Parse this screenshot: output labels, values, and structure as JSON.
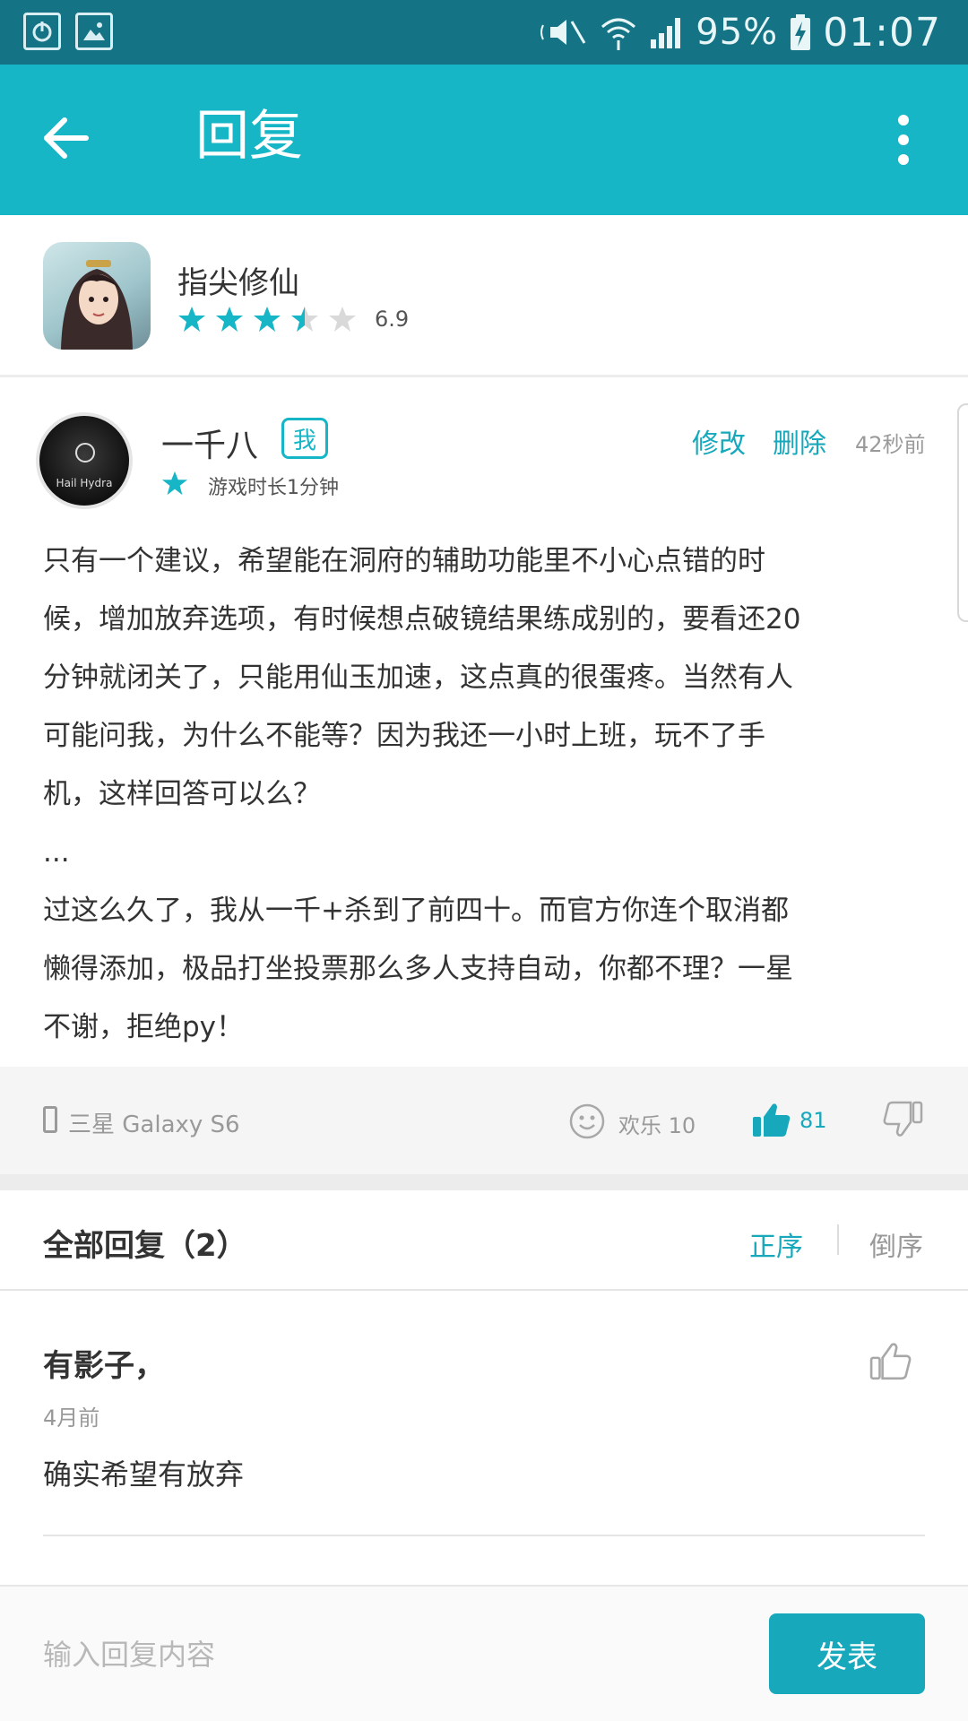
{
  "status_bar": {
    "battery": "95%",
    "time": "01:07",
    "icons": [
      "power-icon",
      "image-icon",
      "mute-icon",
      "wifi-icon",
      "signal-icon",
      "battery-charging-icon"
    ]
  },
  "app_bar": {
    "title": "回复",
    "back_icon": "arrow-left-icon",
    "menu_icon": "more-vertical-icon",
    "background": "#17b6c6"
  },
  "game": {
    "name": "指尖修仙",
    "rating": 3.5,
    "rating_max": 5,
    "score": "6.9"
  },
  "review": {
    "username": "一千八",
    "me_badge": "我",
    "play_time": "游戏时长1分钟",
    "edit": "修改",
    "delete": "删除",
    "time_ago": "42秒前",
    "avatar_text": "Hail Hydra",
    "body": "只有一个建议，希望能在洞府的辅助功能里不小心点错的时\n候，增加放弃选项，有时候想点破镜结果练成别的，要看还20\n分钟就闭关了，只能用仙玉加速，这点真的很蛋疼。当然有人\n可能问我，为什么不能等？因为我还一小时上班，玩不了手\n机，这样回答可以么？\n...\n过这么久了，我从一千+杀到了前四十。而官方你连个取消都\n懒得添加，极品打坐投票那么多人支持自动，你都不理？一星\n不谢，拒绝py！",
    "device": "三星 Galaxy S6",
    "happy": "欢乐 10",
    "likes": "81"
  },
  "replies": {
    "title": "全部回复（2）",
    "sort_asc": "正序",
    "sort_desc": "倒序",
    "items": [
      {
        "author": "有影子，",
        "time": "4月前",
        "text": "确实希望有放弃"
      }
    ]
  },
  "input": {
    "placeholder": "输入回复内容",
    "publish": "发表"
  },
  "colors": {
    "accent": "#17b6c6",
    "status_bar": "#147485",
    "link": "#17a9bb"
  }
}
